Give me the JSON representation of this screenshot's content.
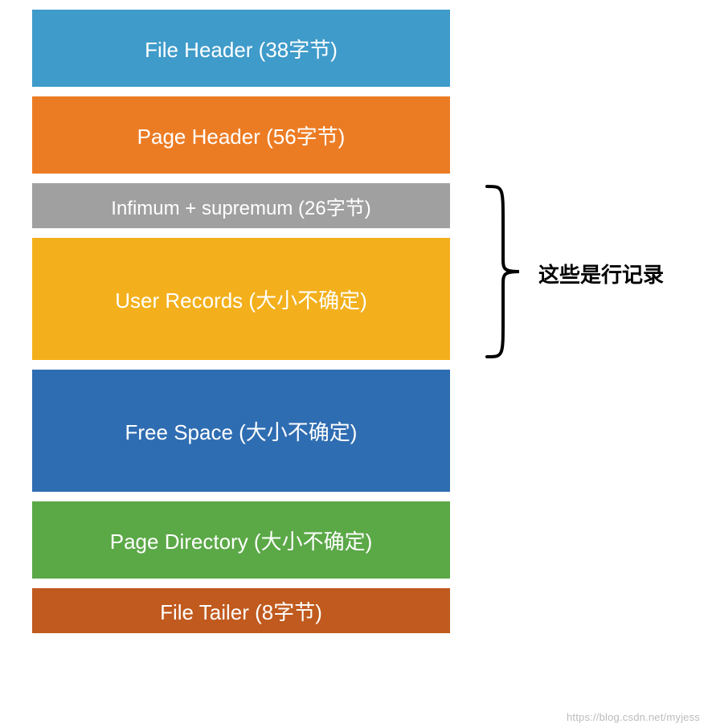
{
  "blocks": {
    "file_header": "File Header (38字节)",
    "page_header": "Page Header (56字节)",
    "infimum": "Infimum + supremum (26字节)",
    "user_records": "User Records (大小不确定)",
    "free_space": "Free Space (大小不确定)",
    "page_directory": "Page Directory (大小不确定)",
    "file_tailer": "File Tailer (8字节)"
  },
  "annotation": "这些是行记录",
  "watermark": "https://blog.csdn.net/myjess",
  "colors": {
    "file_header": "#3f9bca",
    "page_header": "#ec7c24",
    "infimum": "#a0a0a0",
    "user_records": "#f3b01c",
    "free_space": "#2f6db2",
    "page_directory": "#5ba847",
    "file_tailer": "#c05a1e"
  },
  "brace": {
    "top_block_index": 2,
    "bottom_block_index": 3
  }
}
